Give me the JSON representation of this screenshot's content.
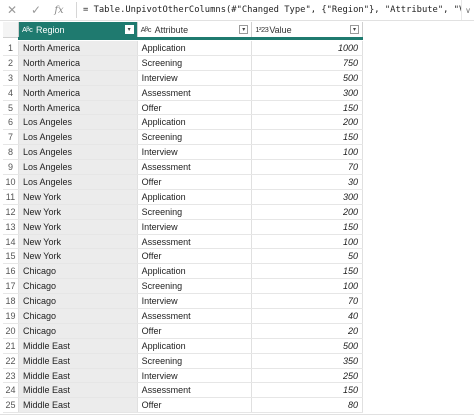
{
  "formula_bar": {
    "cancel_icon": "close-icon",
    "commit_icon": "check-icon",
    "fx_label": "fx",
    "formula": "= Table.UnpivotOtherColumns(#\"Changed Type\", {\"Region\"}, \"Attribute\", \"Value\")",
    "expand_glyph": "∨"
  },
  "columns": [
    {
      "type_icon": "Aᴮc",
      "label": "Region",
      "dropdown": "▾"
    },
    {
      "type_icon": "Aᴮc",
      "label": "Attribute",
      "dropdown": "▾"
    },
    {
      "type_icon": "1²23",
      "label": "Value",
      "dropdown": "▾"
    }
  ],
  "rows": [
    {
      "n": "1",
      "region": "North America",
      "attribute": "Application",
      "value": "1000"
    },
    {
      "n": "2",
      "region": "North America",
      "attribute": "Screening",
      "value": "750"
    },
    {
      "n": "3",
      "region": "North America",
      "attribute": "Interview",
      "value": "500"
    },
    {
      "n": "4",
      "region": "North America",
      "attribute": "Assessment",
      "value": "300"
    },
    {
      "n": "5",
      "region": "North America",
      "attribute": "Offer",
      "value": "150"
    },
    {
      "n": "6",
      "region": "Los Angeles",
      "attribute": "Application",
      "value": "200"
    },
    {
      "n": "7",
      "region": "Los Angeles",
      "attribute": "Screening",
      "value": "150"
    },
    {
      "n": "8",
      "region": "Los Angeles",
      "attribute": "Interview",
      "value": "100"
    },
    {
      "n": "9",
      "region": "Los Angeles",
      "attribute": "Assessment",
      "value": "70"
    },
    {
      "n": "10",
      "region": "Los Angeles",
      "attribute": "Offer",
      "value": "30"
    },
    {
      "n": "11",
      "region": "New York",
      "attribute": "Application",
      "value": "300"
    },
    {
      "n": "12",
      "region": "New York",
      "attribute": "Screening",
      "value": "200"
    },
    {
      "n": "13",
      "region": "New York",
      "attribute": "Interview",
      "value": "150"
    },
    {
      "n": "14",
      "region": "New York",
      "attribute": "Assessment",
      "value": "100"
    },
    {
      "n": "15",
      "region": "New York",
      "attribute": "Offer",
      "value": "50"
    },
    {
      "n": "16",
      "region": "Chicago",
      "attribute": "Application",
      "value": "150"
    },
    {
      "n": "17",
      "region": "Chicago",
      "attribute": "Screening",
      "value": "100"
    },
    {
      "n": "18",
      "region": "Chicago",
      "attribute": "Interview",
      "value": "70"
    },
    {
      "n": "19",
      "region": "Chicago",
      "attribute": "Assessment",
      "value": "40"
    },
    {
      "n": "20",
      "region": "Chicago",
      "attribute": "Offer",
      "value": "20"
    },
    {
      "n": "21",
      "region": "Middle East",
      "attribute": "Application",
      "value": "500"
    },
    {
      "n": "22",
      "region": "Middle East",
      "attribute": "Screening",
      "value": "350"
    },
    {
      "n": "23",
      "region": "Middle East",
      "attribute": "Interview",
      "value": "250"
    },
    {
      "n": "24",
      "region": "Middle East",
      "attribute": "Assessment",
      "value": "150"
    },
    {
      "n": "25",
      "region": "Middle East",
      "attribute": "Offer",
      "value": "80"
    }
  ],
  "colors": {
    "selected_header": "#1f7a6f",
    "region_cell_bg": "#ececec"
  }
}
